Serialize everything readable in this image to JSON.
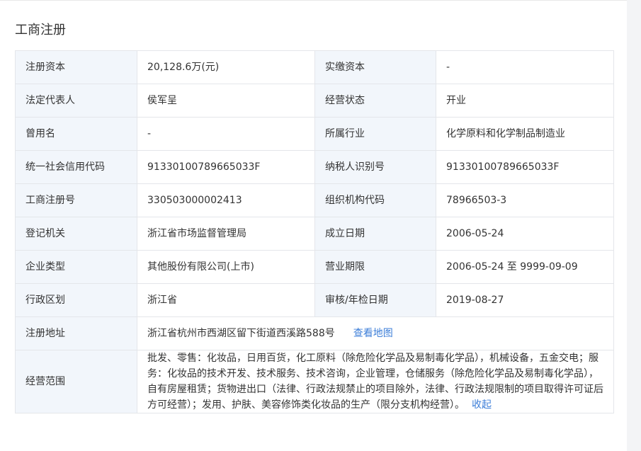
{
  "section": {
    "title": "工商注册"
  },
  "rows": [
    {
      "l1": "注册资本",
      "v1": "20,128.6万(元)",
      "l2": "实缴资本",
      "v2": "-"
    },
    {
      "l1": "法定代表人",
      "v1": "侯军呈",
      "l2": "经营状态",
      "v2": "开业"
    },
    {
      "l1": "曾用名",
      "v1": "-",
      "l2": "所属行业",
      "v2": "化学原料和化学制品制造业"
    },
    {
      "l1": "统一社会信用代码",
      "v1": "91330100789665033F",
      "l2": "纳税人识别号",
      "v2": "91330100789665033F"
    },
    {
      "l1": "工商注册号",
      "v1": "330503000002413",
      "l2": "组织机构代码",
      "v2": "78966503-3"
    },
    {
      "l1": "登记机关",
      "v1": "浙江省市场监督管理局",
      "l2": "成立日期",
      "v2": "2006-05-24"
    },
    {
      "l1": "企业类型",
      "v1": "其他股份有限公司(上市)",
      "l2": "营业期限",
      "v2": "2006-05-24 至 9999-09-09"
    },
    {
      "l1": "行政区划",
      "v1": "浙江省",
      "l2": "审核/年检日期",
      "v2": "2019-08-27"
    }
  ],
  "address": {
    "label": "注册地址",
    "value": "浙江省杭州市西湖区留下街道西溪路588号",
    "map_link": "查看地图"
  },
  "scope": {
    "label": "经营范围",
    "value": "批发、零售：化妆品，日用百货，化工原料（除危险化学品及易制毒化学品），机械设备，五金交电；服务：化妆品的技术开发、技术服务、技术咨询，企业管理，仓储服务（除危险化学品及易制毒化学品），自有房屋租赁；货物进出口（法律、行政法规禁止的项目除外，法律、行政法规限制的项目取得许可证后方可经营）；发用、护肤、美容修饰类化妆品的生产（限分支机构经营）。",
    "collapse_link": "收起"
  },
  "colors": {
    "label_bg": "#f2f6fb",
    "border": "#e4e6ea",
    "link": "#3c7ed8"
  }
}
